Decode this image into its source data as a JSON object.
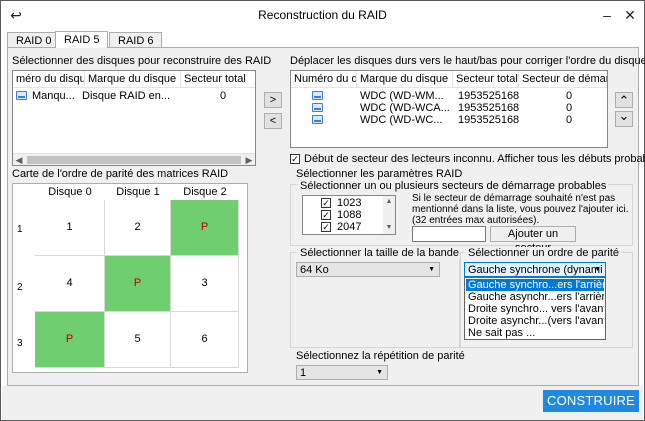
{
  "window": {
    "title": "Reconstruction du RAID",
    "back_glyph": "↩",
    "minimize_glyph": "–",
    "close_glyph": "✕"
  },
  "tabs": [
    {
      "label": "RAID 0"
    },
    {
      "label": "RAID 5"
    },
    {
      "label": "RAID 6"
    }
  ],
  "source": {
    "label": "Sélectionner des disques pour reconstruire des RAID",
    "columns": [
      "méro du disque",
      "Marque du disque",
      "Secteur total"
    ],
    "rows": [
      {
        "num": "Manqu...",
        "brand": "Disque RAID en...",
        "total": "0"
      }
    ]
  },
  "move": {
    "add_glyph": ">",
    "remove_glyph": "<",
    "up_glyph": "⌃",
    "down_glyph": "⌄"
  },
  "target": {
    "label": "Déplacer les disques durs vers le haut/bas pour corriger l'ordre du disque",
    "columns": [
      "Numéro du d",
      "Marque du disque",
      "Secteur total",
      "Secteur de démarrage du"
    ],
    "rows": [
      {
        "brand": "WDC (WD-WM...",
        "total": "1953525168",
        "start": "0"
      },
      {
        "brand": "WDC (WD-WCA...",
        "total": "1953525168",
        "start": "0"
      },
      {
        "brand": "WDC (WD-WC...",
        "total": "1953525168",
        "start": "0"
      }
    ]
  },
  "unknown_start": {
    "checked": true,
    "check_glyph": "✓",
    "label": "Début de secteur des lecteurs inconnu. Afficher tous les débuts probables"
  },
  "parity_map": {
    "label": "Carte de l'ordre de parité des matrices RAID",
    "columns": [
      "Disque 0",
      "Disque 1",
      "Disque 2"
    ],
    "rows": [
      {
        "row": "1",
        "cells": [
          "1",
          "2",
          "P"
        ]
      },
      {
        "row": "2",
        "cells": [
          "4",
          "P",
          "3"
        ]
      },
      {
        "row": "3",
        "cells": [
          "P",
          "5",
          "6"
        ]
      }
    ]
  },
  "params": {
    "label": "Sélectionner les paramètres RAID",
    "start_sectors": {
      "label": "Sélectionner un ou plusieurs secteurs de démarrage probables",
      "items": [
        {
          "value": "1023",
          "checked": true
        },
        {
          "value": "1088",
          "checked": true
        },
        {
          "value": "2047",
          "checked": true
        }
      ],
      "hint": [
        "Si le secteur de démarrage souhaité n'est pas",
        "mentionné dans la liste, vous pouvez l'ajouter ici.",
        "(32 entrées max autorisées)."
      ],
      "input_value": "",
      "add_button": "Ajouter un secteur"
    },
    "stripe": {
      "label": "Sélectionner la taille de la bande",
      "value": "64 Ko"
    },
    "parity_order": {
      "label": "Sélectionner un ordre de parité",
      "value": "Gauche synchrone (dynami",
      "options": [
        "Gauche synchro...ers l'arrière)",
        "Gauche asynchr...ers l'arrière)",
        "Droite synchro... vers l'avant)",
        "Droite asynchr...(vers l'avant)",
        "Ne sait pas ..."
      ],
      "selected_index": 0
    },
    "repetition": {
      "label": "Sélectionnez la répétition de parité",
      "value": "1"
    }
  },
  "build_button": "CONSTRUIRE",
  "colors": {
    "parity_fill": "#6fcf6f",
    "parity_text": "#c00000",
    "accent": "#1e88e5",
    "selection": "#0078d7"
  }
}
